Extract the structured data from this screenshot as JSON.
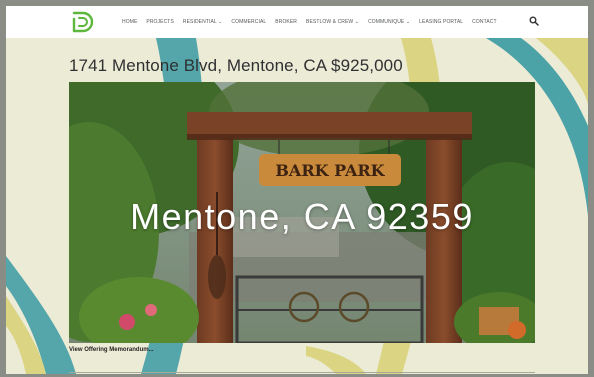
{
  "nav": {
    "items": [
      {
        "label": "HOME"
      },
      {
        "label": "PROJECTS"
      },
      {
        "label": "RESIDENTIAL",
        "dropdown": true
      },
      {
        "label": "COMMERCIAL"
      },
      {
        "label": "BROKER"
      },
      {
        "label": "BESTLOW & CREW",
        "dropdown": true
      },
      {
        "label": "COMMUNIQUE",
        "dropdown": true
      },
      {
        "label": "LEASING PORTAL"
      },
      {
        "label": "CONTACT"
      }
    ],
    "dropdown_glyph": "⌄",
    "icons": {
      "logo": "d-logo",
      "search": "search-icon"
    }
  },
  "listing": {
    "title": "1741 Mentone Blvd, Mentone, CA $925,000",
    "overlay_text": "Mentone, CA 92359",
    "sign_text": "BARK PARK",
    "link_label": "View Offering Memorandum..."
  },
  "colors": {
    "logo_green": "#5cb83c",
    "teal": "#3a9aa2",
    "yellow": "#d8d17a",
    "background": "#ecebd6"
  }
}
